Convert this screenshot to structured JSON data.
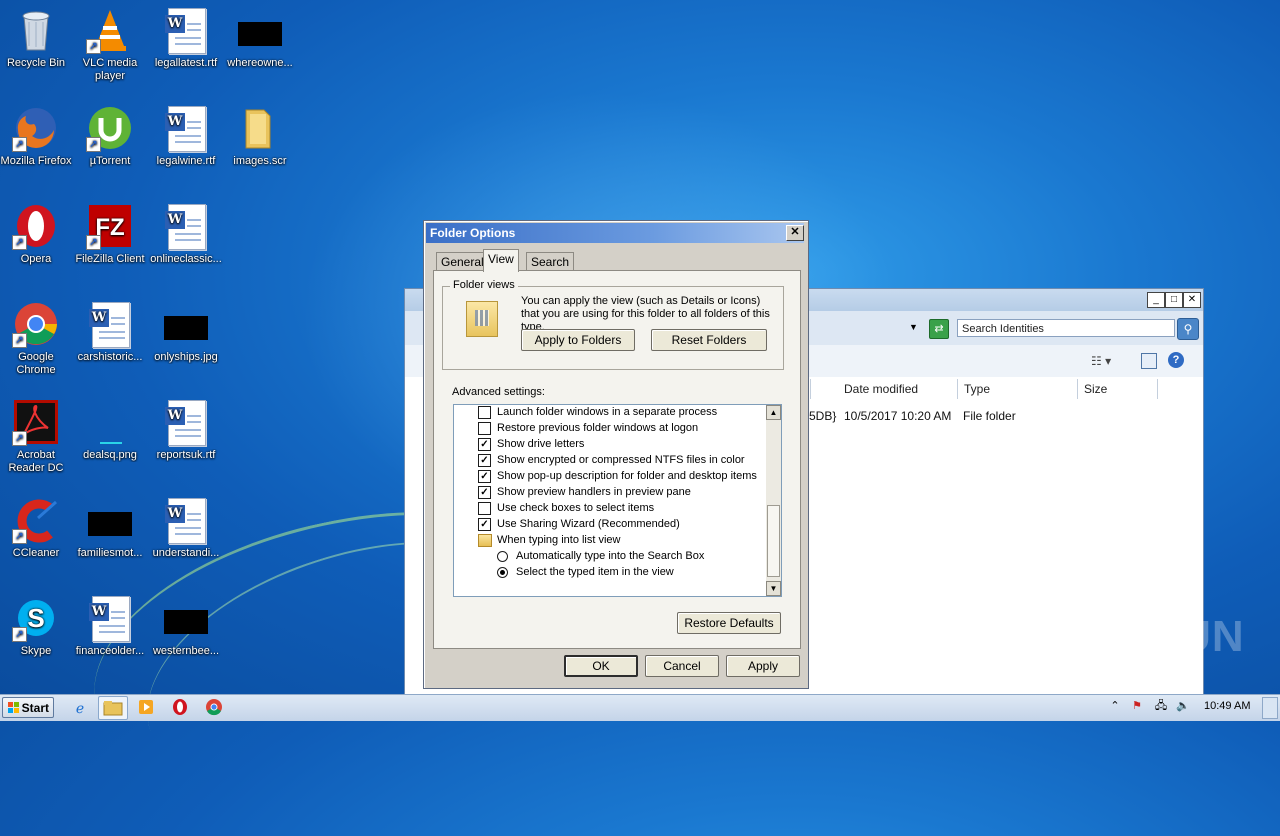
{
  "desktop_icons": [
    {
      "label": "Recycle Bin",
      "icon": "recycle-bin-icon"
    },
    {
      "label": "VLC media player",
      "icon": "vlc-icon"
    },
    {
      "label": "legallatest.rtf",
      "icon": "word-doc-icon"
    },
    {
      "label": "whereowne...",
      "icon": "redacted-thumbnail"
    },
    {
      "label": "Mozilla Firefox",
      "icon": "firefox-icon"
    },
    {
      "label": "µTorrent",
      "icon": "utorrent-icon"
    },
    {
      "label": "legalwine.rtf",
      "icon": "word-doc-icon"
    },
    {
      "label": "images.scr",
      "icon": "folder-icon"
    },
    {
      "label": "Opera",
      "icon": "opera-icon"
    },
    {
      "label": "FileZilla Client",
      "icon": "filezilla-icon"
    },
    {
      "label": "onlineclassic...",
      "icon": "word-doc-icon"
    },
    {
      "label": "Google Chrome",
      "icon": "chrome-icon"
    },
    {
      "label": "carshistoric...",
      "icon": "word-doc-icon"
    },
    {
      "label": "onlyships.jpg",
      "icon": "redacted-thumbnail"
    },
    {
      "label": "Acrobat Reader DC",
      "icon": "acrobat-icon"
    },
    {
      "label": "dealsq.png",
      "icon": "image-thumbnail"
    },
    {
      "label": "reportsuk.rtf",
      "icon": "word-doc-icon"
    },
    {
      "label": "CCleaner",
      "icon": "ccleaner-icon"
    },
    {
      "label": "familiesmot...",
      "icon": "redacted-thumbnail"
    },
    {
      "label": "understandi...",
      "icon": "word-doc-icon"
    },
    {
      "label": "Skype",
      "icon": "skype-icon"
    },
    {
      "label": "financeolder...",
      "icon": "word-doc-icon"
    },
    {
      "label": "westernbee...",
      "icon": "redacted-thumbnail"
    }
  ],
  "explorer": {
    "search_placeholder": "Search Identities",
    "columns": [
      "Date modified",
      "Type",
      "Size"
    ],
    "row": {
      "name_fragment": "5DB}",
      "date": "10/5/2017 10:20 AM",
      "type": "File folder"
    }
  },
  "dialog": {
    "title": "Folder Options",
    "tabs": [
      "General",
      "View",
      "Search"
    ],
    "active_tab": "View",
    "folder_views": {
      "legend": "Folder views",
      "text": "You can apply the view (such as Details or Icons) that you are using for this folder to all folders of this type.",
      "apply_button": "Apply to Folders",
      "reset_button": "Reset Folders"
    },
    "advanced_label": "Advanced settings:",
    "settings": [
      {
        "label": "Launch folder windows in a separate process",
        "kind": "checkbox",
        "checked": false
      },
      {
        "label": "Restore previous folder windows at logon",
        "kind": "checkbox",
        "checked": false
      },
      {
        "label": "Show drive letters",
        "kind": "checkbox",
        "checked": true
      },
      {
        "label": "Show encrypted or compressed NTFS files in color",
        "kind": "checkbox",
        "checked": true
      },
      {
        "label": "Show pop-up description for folder and desktop items",
        "kind": "checkbox",
        "checked": true
      },
      {
        "label": "Show preview handlers in preview pane",
        "kind": "checkbox",
        "checked": true
      },
      {
        "label": "Use check boxes to select items",
        "kind": "checkbox",
        "checked": false
      },
      {
        "label": "Use Sharing Wizard (Recommended)",
        "kind": "checkbox",
        "checked": true
      },
      {
        "label": "When typing into list view",
        "kind": "folder"
      },
      {
        "label": "Automatically type into the Search Box",
        "kind": "radio",
        "checked": false
      },
      {
        "label": "Select the typed item in the view",
        "kind": "radio",
        "checked": true
      }
    ],
    "restore_defaults": "Restore Defaults",
    "ok": "OK",
    "cancel": "Cancel",
    "apply": "Apply"
  },
  "taskbar": {
    "start": "Start",
    "clock": "10:49 AM"
  },
  "watermark": "ANY RUN"
}
